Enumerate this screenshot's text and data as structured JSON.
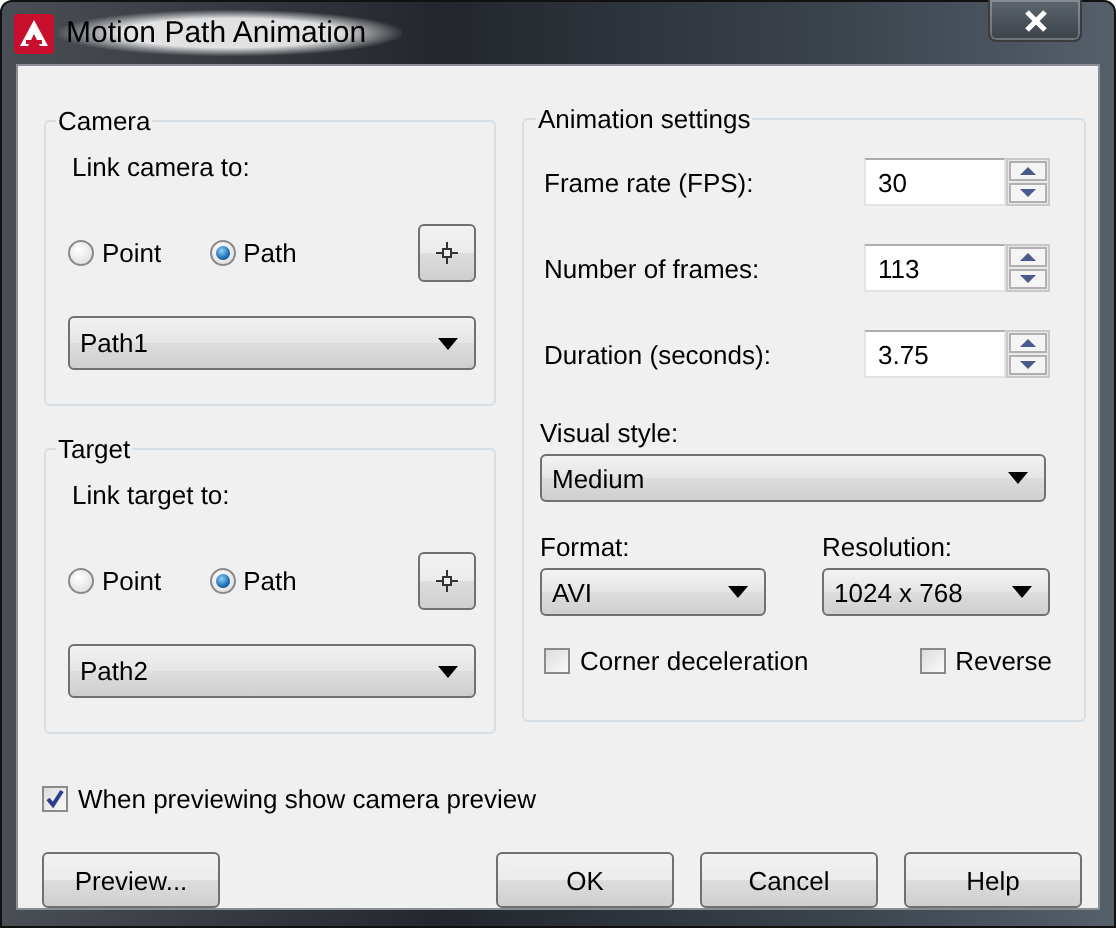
{
  "window": {
    "title": "Motion Path Animation"
  },
  "camera": {
    "title": "Camera",
    "link_label": "Link camera to:",
    "options": [
      {
        "label": "Point",
        "selected": false
      },
      {
        "label": "Path",
        "selected": true
      }
    ],
    "path": "Path1"
  },
  "target": {
    "title": "Target",
    "link_label": "Link target to:",
    "options": [
      {
        "label": "Point",
        "selected": false
      },
      {
        "label": "Path",
        "selected": true
      }
    ],
    "path": "Path2"
  },
  "animation_settings": {
    "title": "Animation settings",
    "fields": [
      {
        "label": "Frame rate (FPS):",
        "value": "30"
      },
      {
        "label": "Number of frames:",
        "value": "113"
      },
      {
        "label": "Duration (seconds):",
        "value": "3.75"
      }
    ],
    "visual_style": {
      "label": "Visual style:",
      "value": "Medium"
    },
    "format": {
      "label": "Format:",
      "value": "AVI"
    },
    "resolution": {
      "label": "Resolution:",
      "value": "1024 x 768"
    },
    "options": [
      {
        "label": "Corner deceleration",
        "checked": false
      },
      {
        "label": "Reverse",
        "checked": false
      }
    ]
  },
  "preview_checkbox": {
    "label": "When previewing show camera preview",
    "checked": true
  },
  "buttons": [
    {
      "label": "Preview..."
    },
    {
      "label": "OK"
    },
    {
      "label": "Cancel"
    },
    {
      "label": "Help"
    }
  ]
}
